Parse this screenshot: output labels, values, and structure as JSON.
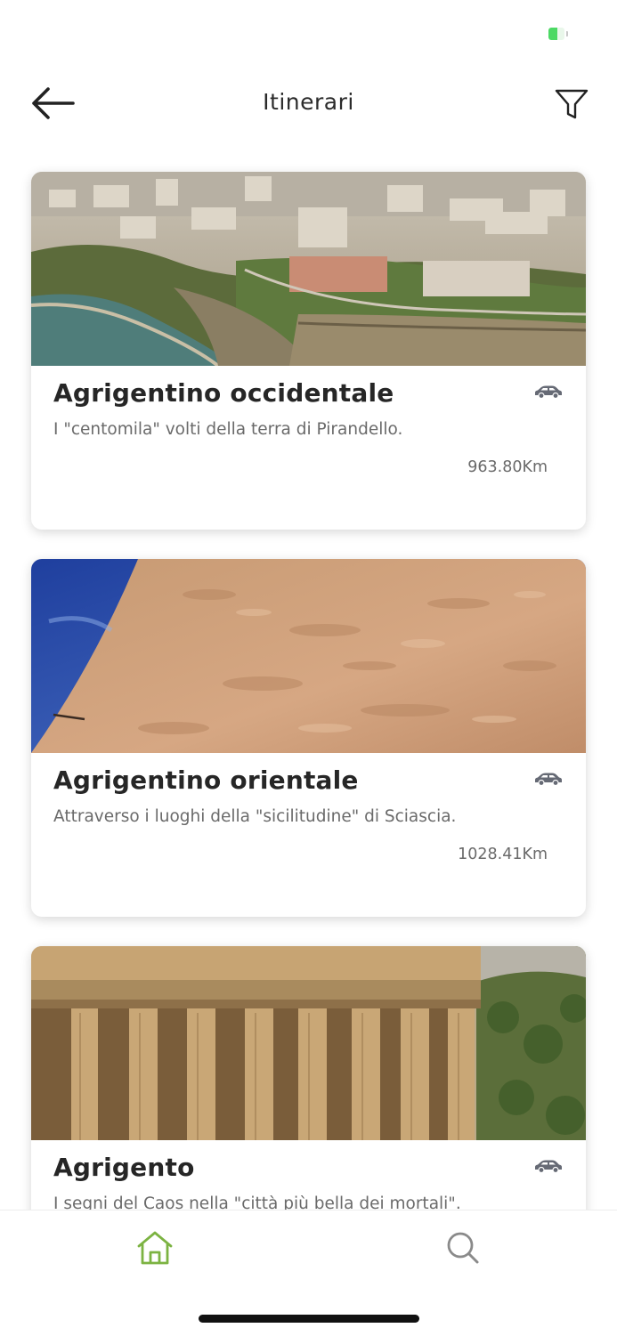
{
  "status_bar": {
    "battery_level": 0.55,
    "battery_color": "#4cd964"
  },
  "header": {
    "title": "Itinerari",
    "back_icon": "arrow-left-icon",
    "filter_icon": "filter-funnel-icon"
  },
  "itineraries": [
    {
      "title": "Agrigentino occidentale",
      "description": "I \"centomila\" volti della terra di Pirandello.",
      "distance": "963.80Km",
      "transport_icon": "car-icon",
      "image": "aerial view of coastal city on cliffs"
    },
    {
      "title": "Agrigentino orientale",
      "description": "Attraverso i luoghi della \"sicilitudine\" di Sciascia.",
      "distance": "1028.41Km",
      "transport_icon": "car-icon",
      "image": "stone tower wall against blue sky"
    },
    {
      "title": "Agrigento",
      "description": "I segni del Caos nella \"città più bella dei mortali\".",
      "distance": "",
      "transport_icon": "car-icon",
      "image": "ancient greek temple columns"
    }
  ],
  "tab_bar": {
    "items": [
      {
        "icon": "home-icon",
        "active": true
      },
      {
        "icon": "search-icon",
        "active": false
      }
    ],
    "active_color": "#7cb342",
    "inactive_color": "#8a8a8a"
  }
}
